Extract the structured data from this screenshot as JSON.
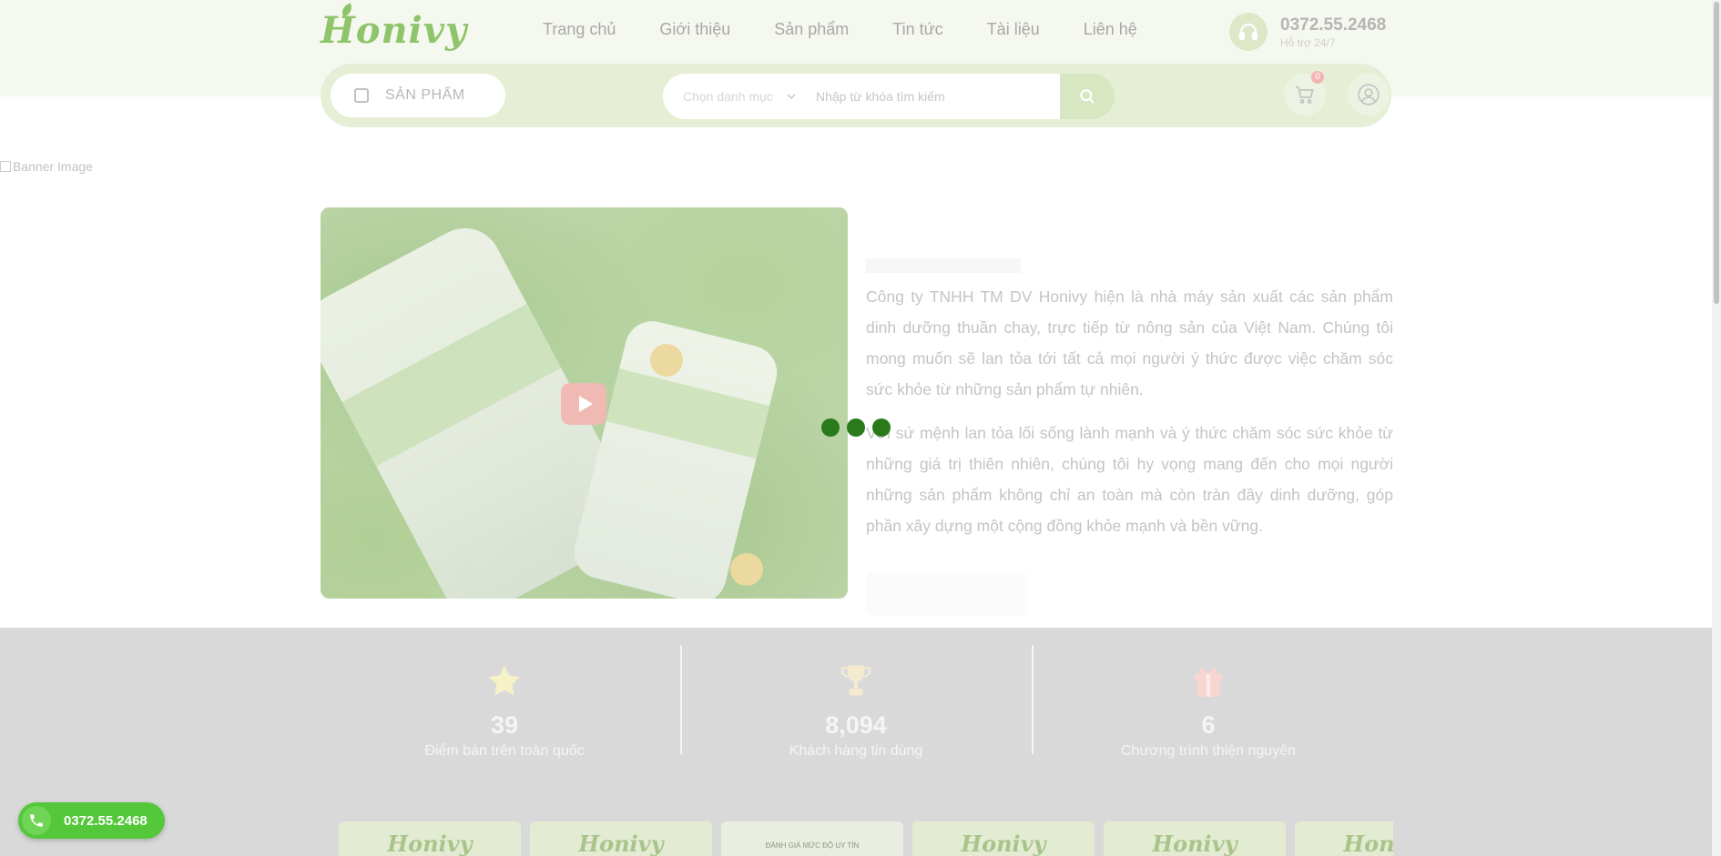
{
  "header": {
    "logo_text": "Honivy",
    "nav": [
      "Trang chủ",
      "Giới thiệu",
      "Sản phẩm",
      "Tin tức",
      "Tài liệu",
      "Liên hệ"
    ],
    "support_phone": "0372.55.2468",
    "support_label": "Hỗ trợ 24/7"
  },
  "searchbar": {
    "products_button": "SẢN PHẨM",
    "category_placeholder": "Chọn danh mục",
    "search_placeholder": "Nhập từ khóa tìm kiếm",
    "cart_count": "0"
  },
  "banner": {
    "alt_text": "Banner Image"
  },
  "about": {
    "paragraph1": "Công ty TNHH TM DV Honivy hiện là nhà máy sản xuất các sản phẩm dinh dưỡng thuần chay, trực tiếp từ nông sản của Việt Nam. Chúng tôi mong muốn sẽ lan tỏa tới tất cả mọi người ý thức được việc chăm sóc sức khỏe từ những sản phẩm tự nhiên.",
    "paragraph2": "Với sứ mệnh lan tỏa lối sống lành mạnh và ý thức chăm sóc sức khỏe từ những giá trị thiên nhiên, chúng tôi hy vọng mang đến cho mọi người những sản phẩm không chỉ an toàn mà còn tràn đầy dinh dưỡng, góp phần xây dựng một cộng đồng khỏe mạnh và bền vững."
  },
  "stats": [
    {
      "icon": "star-icon",
      "value": "39",
      "label": "Điểm bán trên toàn quốc"
    },
    {
      "icon": "trophy-icon",
      "value": "8,094",
      "label": "Khách hàng tin dùng"
    },
    {
      "icon": "gift-icon",
      "value": "6",
      "label": "Chương trình thiện nguyện"
    }
  ],
  "cards": [
    {
      "text": "Honivy"
    },
    {
      "text": "Honivy"
    },
    {
      "text": "ĐÁNH GIÁ MỨC ĐỘ UY TÍN"
    },
    {
      "text": "Honivy"
    },
    {
      "text": "Honivy"
    },
    {
      "text": "Honivy"
    }
  ],
  "floating": {
    "phone": "0372.55.2468"
  },
  "colors": {
    "brand_green": "#8fc46b",
    "loader": "#2a7a1c",
    "phone_button": "#54c73a"
  }
}
